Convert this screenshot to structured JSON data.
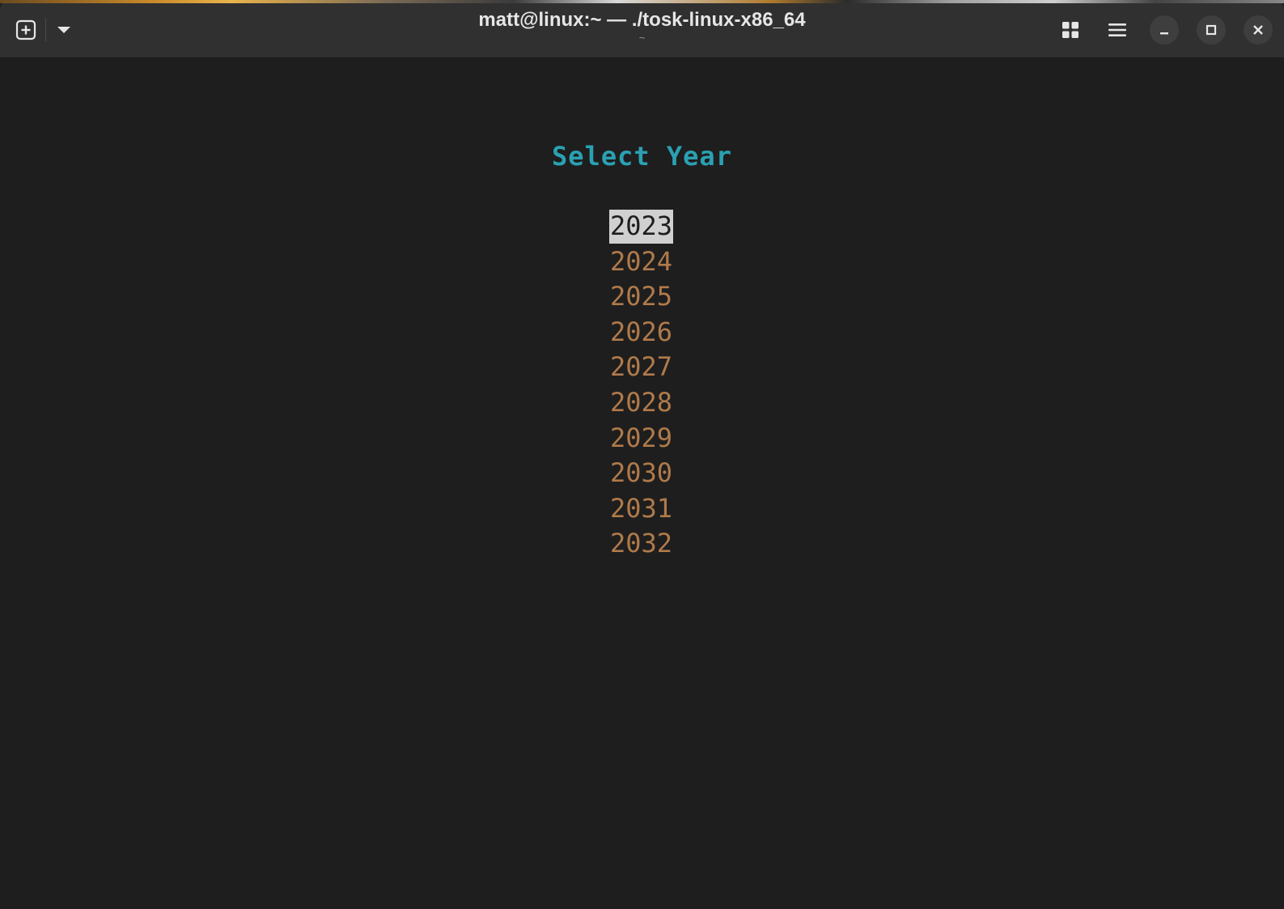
{
  "window": {
    "title": "matt@linux:~ — ./tosk-linux-x86_64",
    "subtitle": "~"
  },
  "headerbar": {
    "new_tab_icon": "plus-square-icon",
    "tab_menu_icon": "chevron-down-icon",
    "view_icon": "grid-icon",
    "menu_icon": "hamburger-menu-icon",
    "minimize_icon": "minimize-icon",
    "maximize_icon": "maximize-icon",
    "close_icon": "close-icon"
  },
  "tui": {
    "title": "Select Year",
    "selected_index": 0,
    "years": [
      "2023",
      "2024",
      "2025",
      "2026",
      "2027",
      "2028",
      "2029",
      "2030",
      "2031",
      "2032"
    ]
  },
  "colors": {
    "background": "#1e1e1e",
    "headerbar": "#303030",
    "title_color": "#2aa1b3",
    "item_color": "#b07a4a",
    "selected_bg": "#d0d0d0",
    "selected_fg": "#1e1e1e"
  }
}
